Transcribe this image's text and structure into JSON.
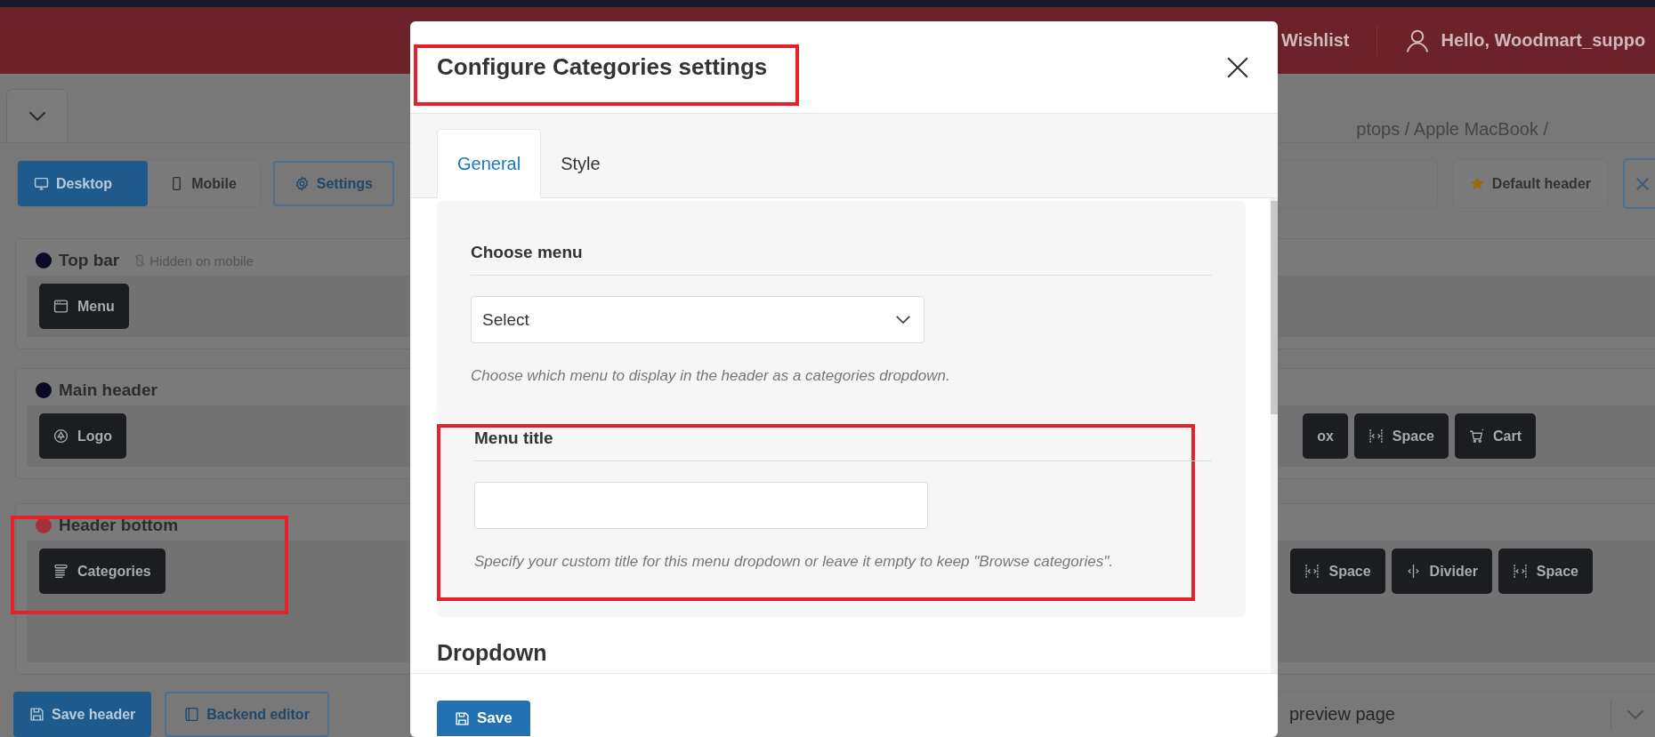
{
  "site_header": {
    "wishlist": "Wishlist",
    "account": "Hello, Woodmart_suppo"
  },
  "breadcrumb": "ptops / Apple MacBook /",
  "view_tabs": [
    {
      "label": "Desktop",
      "selected": true
    },
    {
      "label": "Mobile",
      "selected": false
    }
  ],
  "settings_button": "Settings",
  "default_header_button": "Default header",
  "sections": [
    {
      "title": "Top bar",
      "color": "#0b0a24",
      "note": "Hidden on mobile",
      "left": [
        {
          "label": "Menu",
          "kind": "menu"
        }
      ]
    },
    {
      "title": "Main header",
      "color": "#0b0a24",
      "left": [
        {
          "label": "Logo",
          "kind": "logo"
        }
      ],
      "right": [
        {
          "label": "ox",
          "kind": "plain"
        },
        {
          "label": "Space",
          "kind": "space"
        },
        {
          "label": "Cart",
          "kind": "cart"
        }
      ]
    },
    {
      "title": "Header bottom",
      "color": "#a3303b",
      "left": [
        {
          "label": "Categories",
          "kind": "categories"
        }
      ],
      "right": [
        {
          "label": "Space",
          "kind": "space"
        },
        {
          "label": "Divider",
          "kind": "divider"
        },
        {
          "label": "Space",
          "kind": "space"
        }
      ]
    }
  ],
  "footer": {
    "save_header": "Save header",
    "backend_editor": "Backend editor",
    "preview_select": "preview page"
  },
  "modal": {
    "title": "Configure Categories settings",
    "tabs": [
      {
        "label": "General",
        "selected": true
      },
      {
        "label": "Style",
        "selected": false
      }
    ],
    "fields": [
      {
        "kind": "select",
        "label": "Choose menu",
        "value": "Select",
        "help": "Choose which menu to display in the header as a categories dropdown.",
        "highlighted": false
      },
      {
        "kind": "text",
        "label": "Menu title",
        "help": "Specify your custom title for this menu dropdown or leave it empty to keep \"Browse categories\".",
        "highlighted": true
      }
    ],
    "next_heading": "Dropdown",
    "save_button": "Save"
  }
}
